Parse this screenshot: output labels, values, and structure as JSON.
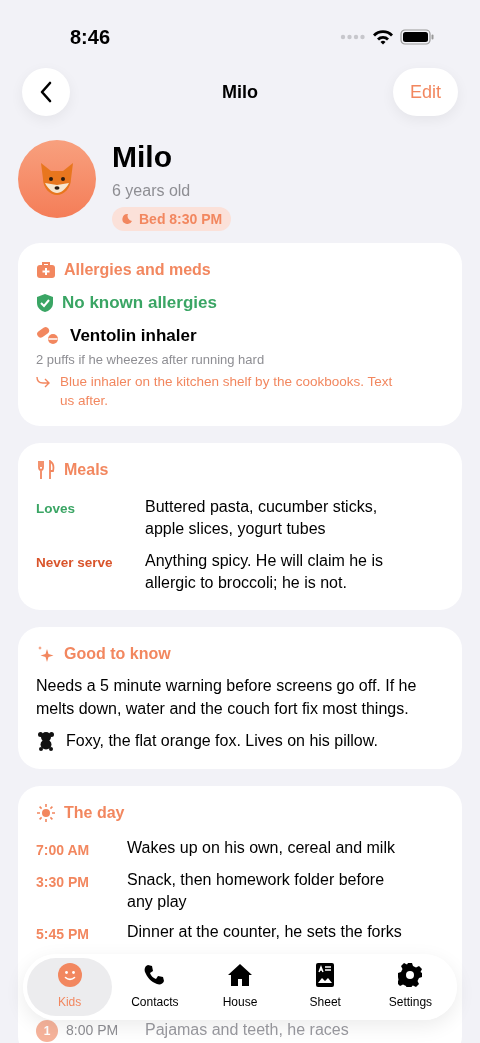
{
  "status_bar": {
    "time": "8:46"
  },
  "nav": {
    "title": "Milo",
    "edit": "Edit"
  },
  "profile": {
    "name": "Milo",
    "age": "6 years old",
    "bedtime": "Bed 8:30 PM"
  },
  "allergies": {
    "title": "Allergies and meds",
    "status": "No known allergies",
    "med": {
      "name": "Ventolin inhaler",
      "dose": "2 puffs if he wheezes after running hard",
      "note": "Blue inhaler on the kitchen shelf by the cookbooks. Text us after."
    }
  },
  "meals": {
    "title": "Meals",
    "rows": [
      {
        "label": "Loves",
        "kind": "likes",
        "text": "Buttered pasta, cucumber sticks, apple slices, yogurt tubes"
      },
      {
        "label": "Never serve",
        "kind": "avoid",
        "text": "Anything spicy. He will claim he is allergic to broccoli; he is not."
      }
    ]
  },
  "good_to_know": {
    "title": "Good to know",
    "text": "Needs a 5 minute warning before screens go off. If he melts down, water and the couch fort fix most things.",
    "comfort": "Foxy, the flat orange fox. Lives on his pillow."
  },
  "the_day": {
    "title": "The day",
    "rows": [
      {
        "time": "7:00 AM",
        "text": "Wakes up on his own, cereal and milk"
      },
      {
        "time": "3:30 PM",
        "text": "Snack, then homework folder before any play"
      },
      {
        "time": "5:45 PM",
        "text": "Dinner at the counter, he sets the forks"
      },
      {
        "time": "8:00 PM",
        "text": "Pajamas and teeth, he races",
        "badge": "1"
      }
    ]
  },
  "tab_bar": [
    {
      "label": "Kids",
      "selected": true
    },
    {
      "label": "Contacts",
      "selected": false
    },
    {
      "label": "House",
      "selected": false
    },
    {
      "label": "Sheet",
      "selected": false
    },
    {
      "label": "Settings",
      "selected": false
    }
  ]
}
